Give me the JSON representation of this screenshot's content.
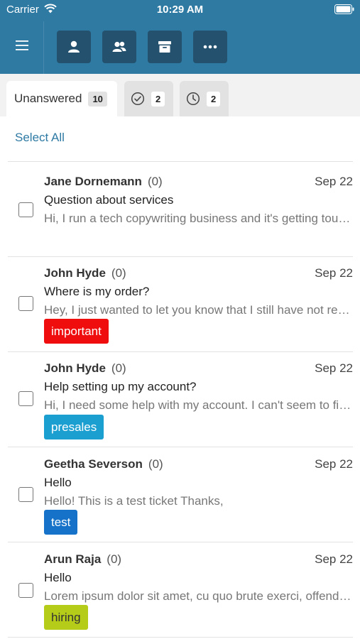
{
  "status_bar": {
    "carrier": "Carrier",
    "time": "10:29 AM"
  },
  "toolbar": {
    "menu_icon": "hamburger-menu-icon",
    "buttons": [
      {
        "icon": "user-icon"
      },
      {
        "icon": "users-icon"
      },
      {
        "icon": "archive-icon"
      },
      {
        "icon": "more-icon"
      }
    ],
    "header_color": "#2e7aa3",
    "button_color": "#24516d"
  },
  "tabs": [
    {
      "label": "Unanswered",
      "count": "10",
      "active": true
    },
    {
      "icon": "check-circle-icon",
      "count": "2",
      "active": false
    },
    {
      "icon": "clock-icon",
      "count": "2",
      "active": false
    }
  ],
  "select_all": "Select All",
  "tickets": [
    {
      "name": "Jane Dornemann",
      "count": "(0)",
      "date": "Sep 22",
      "subject": "Question about services",
      "preview": "Hi, I run a tech copywriting business and it's getting tough to keep up with everything",
      "tag": null
    },
    {
      "name": "John Hyde",
      "count": "(0)",
      "date": "Sep 22",
      "subject": "Where is my order?",
      "preview": "Hey, I just wanted to let you know that I still have not received my order",
      "tag": {
        "label": "important",
        "color": "#ef0d0d"
      }
    },
    {
      "name": "John Hyde",
      "count": "(0)",
      "date": "Sep 22",
      "subject": "Help setting up my account?",
      "preview": "Hi, I need some help with my account. I can't seem to find the settings",
      "tag": {
        "label": "presales",
        "color": "#1b9fd1"
      }
    },
    {
      "name": "Geetha Severson",
      "count": "(0)",
      "date": "Sep 22",
      "subject": "Hello",
      "preview": "Hello! This is a test ticket Thanks,",
      "tag": {
        "label": "test",
        "color": "#1672c8"
      }
    },
    {
      "name": "Arun Raja",
      "count": "(0)",
      "date": "Sep 22",
      "subject": "Hello",
      "preview": "Lorem ipsum dolor sit amet, cu quo brute exerci, offendit scaevola",
      "tag": {
        "label": "hiring",
        "color": "#b5cc18"
      }
    }
  ]
}
